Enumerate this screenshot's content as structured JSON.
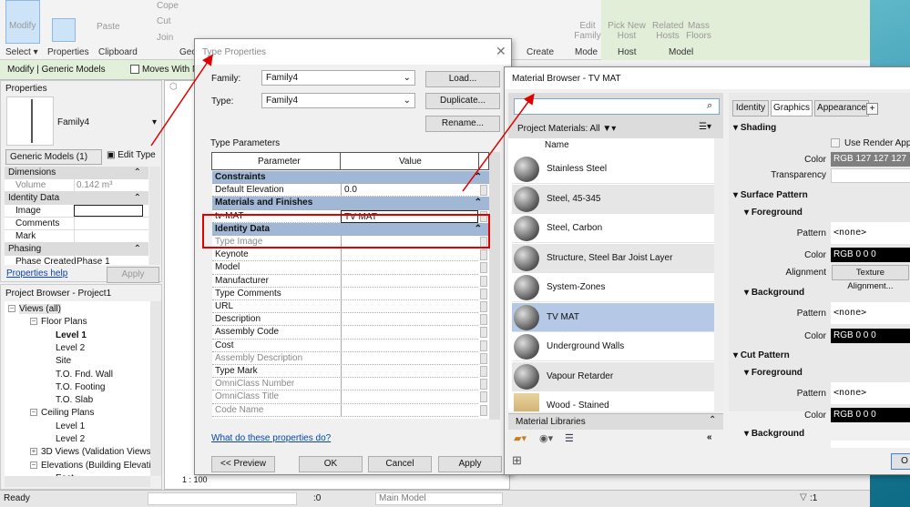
{
  "ribbon": {
    "modify": "Modify",
    "select": "Select ▾",
    "properties": "Properties",
    "paste": "Paste",
    "clipboard": "Clipboard",
    "cope": "Cope",
    "cut": "Cut",
    "join": "Join",
    "geo": "Geo",
    "create": "Create",
    "edit_family": "Edit Family",
    "mode": "Mode",
    "pick_new_host": "Pick New Host",
    "host": "Host",
    "related_hosts": "Related Hosts",
    "mass_floors": "Mass Floors",
    "model": "Model"
  },
  "context_bar": {
    "label": "Modify | Generic Models",
    "moves_with": "Moves With N"
  },
  "properties_panel": {
    "title": "Properties",
    "family": "Family4",
    "type_selector": "Generic Models (1)",
    "edit_type": "Edit Type",
    "rows": [
      {
        "cat": "Dimensions"
      },
      {
        "p": "Volume",
        "v": "0.142 m³",
        "gray": true
      },
      {
        "cat": "Identity Data"
      },
      {
        "p": "Image",
        "v": ""
      },
      {
        "p": "Comments",
        "v": ""
      },
      {
        "p": "Mark",
        "v": ""
      },
      {
        "cat": "Phasing"
      },
      {
        "p": "Phase Created",
        "v": "Phase 1"
      }
    ],
    "help": "Properties help",
    "apply": "Apply"
  },
  "project_browser": {
    "title": "Project Browser - Project1",
    "items": [
      "Views (all)",
      "Floor Plans",
      "Level 1",
      "Level 2",
      "Site",
      "T.O. Fnd. Wall",
      "T.O. Footing",
      "T.O. Slab",
      "Ceiling Plans",
      "Level 1",
      "Level 2",
      "3D Views (Validation Views)",
      "Elevations (Building Elevation",
      "East"
    ]
  },
  "view": {
    "scale": "1 : 100"
  },
  "status": {
    "text": "Ready",
    "zero": ":0",
    "workset": "Main Model",
    "filter": ":1"
  },
  "type_properties": {
    "title": "Type Properties",
    "family_label": "Family:",
    "family_value": "Family4",
    "type_label": "Type:",
    "type_value": "Family4",
    "load": "Load...",
    "duplicate": "Duplicate...",
    "rename": "Rename...",
    "section": "Type Parameters",
    "col_param": "Parameter",
    "col_value": "Value",
    "rows": [
      {
        "cat": "Constraints"
      },
      {
        "p": "Default Elevation",
        "v": "0.0"
      },
      {
        "cat": "Materials and Finishes"
      },
      {
        "p": "tv-MAT",
        "v": "TV MAT"
      },
      {
        "cat": "Identity Data"
      },
      {
        "p": "Type Image",
        "gray": true
      },
      {
        "p": "Keynote"
      },
      {
        "p": "Model"
      },
      {
        "p": "Manufacturer"
      },
      {
        "p": "Type Comments"
      },
      {
        "p": "URL"
      },
      {
        "p": "Description"
      },
      {
        "p": "Assembly Code"
      },
      {
        "p": "Cost"
      },
      {
        "p": "Assembly Description",
        "gray": true
      },
      {
        "p": "Type Mark"
      },
      {
        "p": "OmniClass Number",
        "gray": true
      },
      {
        "p": "OmniClass Title",
        "gray": true
      },
      {
        "p": "Code Name",
        "gray": true
      }
    ],
    "help": "What do these properties do?",
    "preview": "<< Preview",
    "ok": "OK",
    "cancel": "Cancel",
    "apply": "Apply"
  },
  "material_browser": {
    "title": "Material Browser - TV MAT",
    "search_placeholder": "",
    "filter": "Project Materials: All",
    "name_col": "Name",
    "materials": [
      "Stainless Steel",
      "Steel, 45-345",
      "Steel, Carbon",
      "Structure, Steel Bar Joist Layer",
      "System-Zones",
      "TV MAT",
      "Underground Walls",
      "Vapour Retarder",
      "Wood - Stained"
    ],
    "selected": "TV MAT",
    "libraries": "Material Libraries",
    "tabs": [
      "Identity",
      "Graphics",
      "Appearance"
    ],
    "active_tab": "Graphics",
    "shading": "Shading",
    "use_render": "Use Render Appea",
    "color": "Color",
    "shading_color": "RGB 127 127 127",
    "transparency": "Transparency",
    "surface_pattern": "Surface Pattern",
    "foreground": "Foreground",
    "background": "Background",
    "pattern": "Pattern",
    "none": "<none>",
    "black": "RGB 0 0 0",
    "alignment": "Alignment",
    "texture_alignment": "Texture Alignment...",
    "cut_pattern": "Cut Pattern",
    "ok_partial": "O"
  },
  "colors": {
    "selected_row": "#b5c9e6",
    "category_row": "#a0b8d6",
    "highlight_box": "#e00000",
    "arrow": "#e00000",
    "ribbon_green": "#e3eed8"
  }
}
